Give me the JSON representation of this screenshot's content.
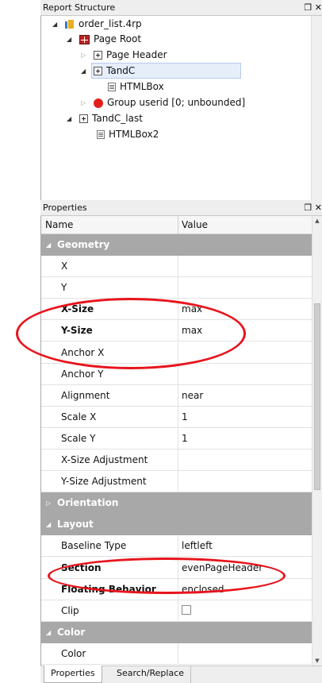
{
  "report_structure": {
    "title": "Report Structure",
    "controls": "❐ ✕",
    "nodes": [
      {
        "label": "order_list.4rp",
        "icon": "report-file-icon",
        "expander": "open"
      },
      {
        "label": "Page Root",
        "icon": "page-root-icon",
        "expander": "open"
      },
      {
        "label": "Page Header",
        "icon": "expand-box-icon",
        "expander": "closed"
      },
      {
        "label": "TandC",
        "icon": "expand-box-icon",
        "expander": "open",
        "selected": true
      },
      {
        "label": "HTMLBox",
        "icon": "html-box-icon",
        "expander": "none"
      },
      {
        "label": "Group userid [0; unbounded]",
        "icon": "group-red-icon",
        "expander": "closed"
      },
      {
        "label": "TandC_last",
        "icon": "expand-box-icon",
        "expander": "open"
      },
      {
        "label": "HTMLBox2",
        "icon": "html-box-icon",
        "expander": "none"
      }
    ]
  },
  "properties": {
    "title": "Properties",
    "controls": "❐ ✕",
    "columns": {
      "name": "Name",
      "value": "Value"
    },
    "rows": [
      {
        "type": "cat",
        "name": "Geometry",
        "expander": "open"
      },
      {
        "type": "prop",
        "name": "X",
        "value": ""
      },
      {
        "type": "prop",
        "name": "Y",
        "value": ""
      },
      {
        "type": "prop",
        "name": "X-Size",
        "value": "max",
        "bold": true
      },
      {
        "type": "prop",
        "name": "Y-Size",
        "value": "max",
        "bold": true
      },
      {
        "type": "prop",
        "name": "Anchor X",
        "value": ""
      },
      {
        "type": "prop",
        "name": "Anchor Y",
        "value": ""
      },
      {
        "type": "prop",
        "name": "Alignment",
        "value": "near"
      },
      {
        "type": "prop",
        "name": "Scale X",
        "value": "1"
      },
      {
        "type": "prop",
        "name": "Scale Y",
        "value": "1"
      },
      {
        "type": "prop",
        "name": "X-Size Adjustment",
        "value": ""
      },
      {
        "type": "prop",
        "name": "Y-Size Adjustment",
        "value": ""
      },
      {
        "type": "cat",
        "name": "Orientation",
        "expander": "closed"
      },
      {
        "type": "cat",
        "name": "Layout",
        "expander": "open"
      },
      {
        "type": "prop",
        "name": "Baseline Type",
        "value": "leftleft"
      },
      {
        "type": "prop",
        "name": "Section",
        "value": "evenPageHeader",
        "bold": true
      },
      {
        "type": "prop",
        "name": "Floating Behavior",
        "value": "enclosed",
        "bold": true
      },
      {
        "type": "prop",
        "name": "Clip",
        "value": "",
        "checkbox": true,
        "checked": false
      },
      {
        "type": "cat",
        "name": "Color",
        "expander": "open"
      },
      {
        "type": "prop",
        "name": "Color",
        "value": ""
      }
    ]
  },
  "tabs": [
    {
      "label": "Properties",
      "active": true
    },
    {
      "label": "Search/Replace",
      "active": false
    }
  ],
  "annotation_color": "#e8141c"
}
